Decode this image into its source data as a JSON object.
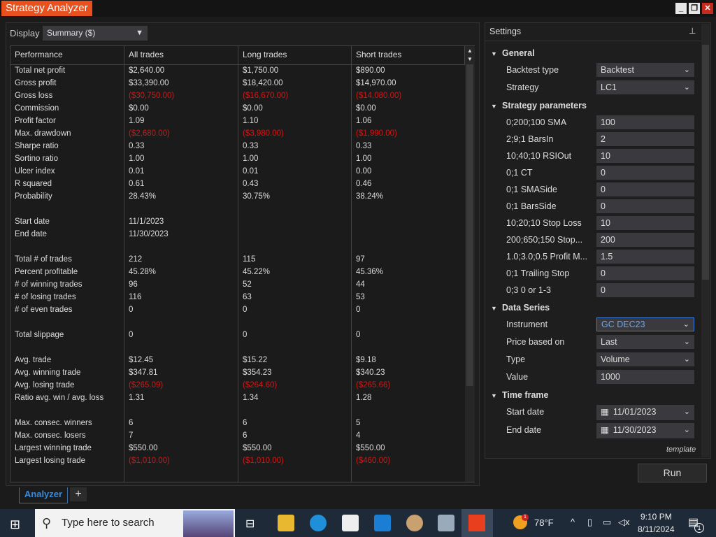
{
  "window": {
    "title": "Strategy Analyzer"
  },
  "display": {
    "label": "Display",
    "value": "Summary ($)"
  },
  "table": {
    "headers": [
      "Performance",
      "All trades",
      "Long trades",
      "Short trades"
    ],
    "rows": [
      [
        "Total net profit",
        "$2,640.00",
        "$1,750.00",
        "$890.00"
      ],
      [
        "Gross profit",
        "$33,390.00",
        "$18,420.00",
        "$14,970.00"
      ],
      [
        "Gross loss",
        "($30,750.00)",
        "($16,670.00)",
        "($14,080.00)"
      ],
      [
        "Commission",
        "$0.00",
        "$0.00",
        "$0.00"
      ],
      [
        "Profit factor",
        "1.09",
        "1.10",
        "1.06"
      ],
      [
        "Max. drawdown",
        "($2,680.00)",
        "($3,980.00)",
        "($1,990.00)"
      ],
      [
        "Sharpe ratio",
        "0.33",
        "0.33",
        "0.33"
      ],
      [
        "Sortino ratio",
        "1.00",
        "1.00",
        "1.00"
      ],
      [
        "Ulcer index",
        "0.01",
        "0.01",
        "0.00"
      ],
      [
        "R squared",
        "0.61",
        "0.43",
        "0.46"
      ],
      [
        "Probability",
        "28.43%",
        "30.75%",
        "38.24%"
      ],
      null,
      [
        "Start date",
        "11/1/2023",
        "",
        ""
      ],
      [
        "End date",
        "11/30/2023",
        "",
        ""
      ],
      null,
      [
        "Total # of trades",
        "212",
        "115",
        "97"
      ],
      [
        "Percent profitable",
        "45.28%",
        "45.22%",
        "45.36%"
      ],
      [
        "# of winning trades",
        "96",
        "52",
        "44"
      ],
      [
        "# of losing trades",
        "116",
        "63",
        "53"
      ],
      [
        "# of even trades",
        "0",
        "0",
        "0"
      ],
      null,
      [
        "Total slippage",
        "0",
        "0",
        "0"
      ],
      null,
      [
        "Avg. trade",
        "$12.45",
        "$15.22",
        "$9.18"
      ],
      [
        "Avg. winning trade",
        "$347.81",
        "$354.23",
        "$340.23"
      ],
      [
        "Avg. losing trade",
        "($265.09)",
        "($264.60)",
        "($265.66)"
      ],
      [
        "Ratio avg. win / avg. loss",
        "1.31",
        "1.34",
        "1.28"
      ],
      null,
      [
        "Max. consec. winners",
        "6",
        "6",
        "5"
      ],
      [
        "Max. consec. losers",
        "7",
        "6",
        "4"
      ],
      [
        "Largest winning trade",
        "$550.00",
        "$550.00",
        "$550.00"
      ],
      [
        "Largest losing trade",
        "($1,010.00)",
        "($1,010.00)",
        "($460.00)"
      ]
    ]
  },
  "settings": {
    "title": "Settings",
    "sections": [
      {
        "title": "General",
        "items": [
          {
            "label": "Backtest type",
            "value": "Backtest",
            "dropdown": true
          },
          {
            "label": "Strategy",
            "value": "LC1",
            "dropdown": true
          }
        ]
      },
      {
        "title": "Strategy parameters",
        "items": [
          {
            "label": "0;200;100 SMA",
            "value": "100"
          },
          {
            "label": "2;9;1 BarsIn",
            "value": "2"
          },
          {
            "label": "10;40;10 RSIOut",
            "value": "10"
          },
          {
            "label": "0;1 CT",
            "value": "0"
          },
          {
            "label": "0;1 SMASide",
            "value": "0"
          },
          {
            "label": "0;1 BarsSide",
            "value": "0"
          },
          {
            "label": "10;20;10 Stop Loss",
            "value": "10"
          },
          {
            "label": "200;650;150 Stop...",
            "value": "200"
          },
          {
            "label": "1.0;3.0;0.5 Profit M...",
            "value": "1.5"
          },
          {
            "label": "0;1 Trailing Stop",
            "value": "0"
          },
          {
            "label": "0;3 0 or 1-3",
            "value": "0"
          }
        ]
      },
      {
        "title": "Data Series",
        "items": [
          {
            "label": "Instrument",
            "value": "GC DEC23",
            "dropdown": true,
            "selected": true
          },
          {
            "label": "Price based on",
            "value": "Last",
            "dropdown": true
          },
          {
            "label": "Type",
            "value": "Volume",
            "dropdown": true
          },
          {
            "label": "Value",
            "value": "1000"
          }
        ]
      },
      {
        "title": "Time frame",
        "items": [
          {
            "label": "Start date",
            "value": "11/01/2023",
            "dropdown": true,
            "calendar": true
          },
          {
            "label": "End date",
            "value": "11/30/2023",
            "dropdown": true,
            "calendar": true
          }
        ]
      }
    ],
    "template_label": "template",
    "run_label": "Run"
  },
  "tabs": {
    "active": "Analyzer",
    "add": "+"
  },
  "taskbar": {
    "search_placeholder": "Type here to search",
    "weather": "78°F",
    "weather_badge": "1",
    "time": "9:10 PM",
    "date": "8/11/2024",
    "notifications": "1"
  },
  "colors": {
    "accent": "#e8501e",
    "negative": "#d01818",
    "selection": "#3d7bd6"
  }
}
